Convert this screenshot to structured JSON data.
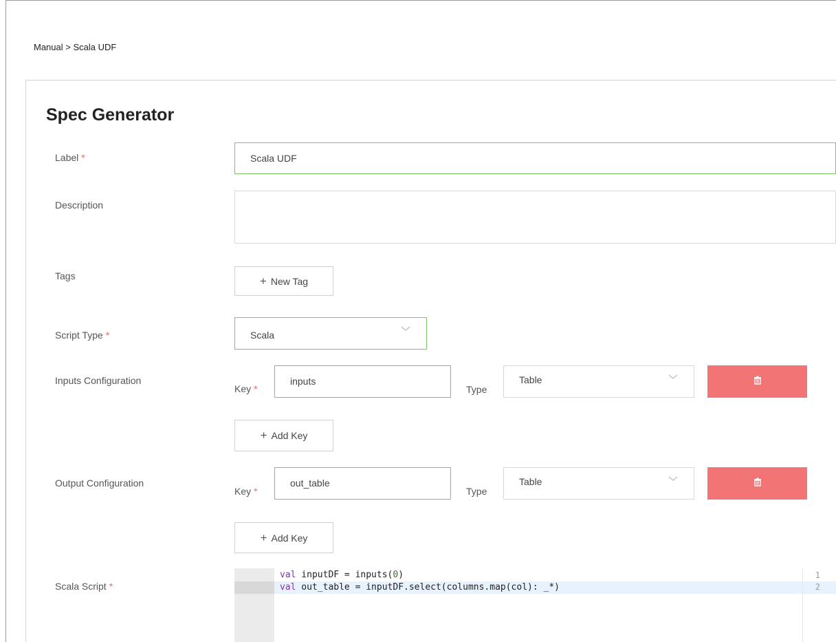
{
  "breadcrumb": "Manual > Scala UDF",
  "title": "Spec Generator",
  "required_mark": "*",
  "fields": {
    "label": {
      "label": "Label",
      "value": "Scala UDF"
    },
    "description": {
      "label": "Description",
      "value": ""
    },
    "tags": {
      "label": "Tags",
      "new_tag_button": "New Tag"
    },
    "script_type": {
      "label": "Script Type",
      "value": "Scala"
    },
    "inputs": {
      "label": "Inputs Configuration",
      "key_label": "Key",
      "key_value": "inputs",
      "type_label": "Type",
      "type_value": "Table",
      "add_key_button": "Add Key"
    },
    "outputs": {
      "label": "Output Configuration",
      "key_label": "Key",
      "key_value": "out_table",
      "type_label": "Type",
      "type_value": "Table",
      "add_key_button": "Add Key"
    },
    "scala_script": {
      "label": "Scala Script",
      "line_numbers": [
        "1",
        "2"
      ],
      "lines": [
        {
          "kw": "val",
          "rest": " inputDF = inputs(",
          "num": "0",
          "tail": ")"
        },
        {
          "kw": "val",
          "rest": " out_table = inputDF.select(columns.map(col): _*)",
          "num": "",
          "tail": ""
        }
      ]
    }
  },
  "colors": {
    "accent_border": "#7cc567",
    "required": "#f06a6a",
    "delete_button": "#f27474"
  },
  "icons": {
    "plus": "plus-icon",
    "chevron": "chevron-down-icon",
    "trash": "trash-icon"
  }
}
